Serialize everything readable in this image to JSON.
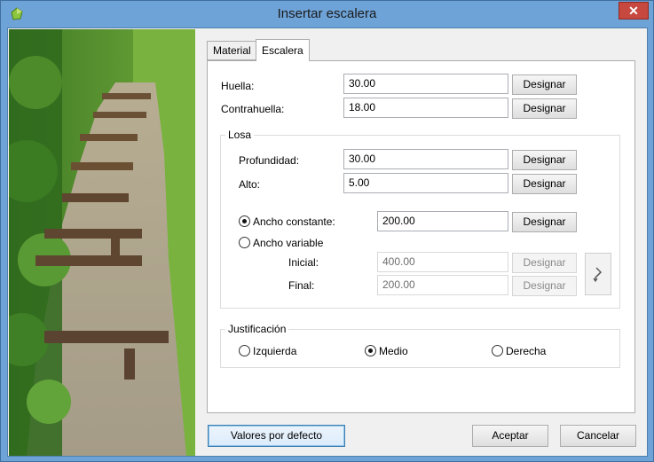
{
  "window": {
    "title": "Insertar escalera",
    "close_symbol": "✕"
  },
  "tabs": [
    {
      "label": "Material"
    },
    {
      "label": "Escalera"
    }
  ],
  "huella": {
    "label": "Huella:",
    "value": "30.00",
    "button": "Designar"
  },
  "contrahuella": {
    "label": "Contrahuella:",
    "value": "18.00",
    "button": "Designar"
  },
  "losa": {
    "title": "Losa",
    "profundidad": {
      "label": "Profundidad:",
      "value": "30.00",
      "button": "Designar"
    },
    "alto": {
      "label": "Alto:",
      "value": "5.00",
      "button": "Designar"
    },
    "ancho_constante": {
      "label": "Ancho constante:",
      "value": "200.00",
      "button": "Designar",
      "selected": true
    },
    "ancho_variable": {
      "label": "Ancho variable",
      "selected": false
    },
    "inicial": {
      "label": "Inicial:",
      "value": "400.00",
      "button": "Designar"
    },
    "final": {
      "label": "Final:",
      "value": "200.00",
      "button": "Designar"
    },
    "swap_icon": "swap-arrows-icon"
  },
  "justificacion": {
    "title": "Justificación",
    "options": [
      {
        "label": "Izquierda",
        "selected": false
      },
      {
        "label": "Medio",
        "selected": true
      },
      {
        "label": "Derecha",
        "selected": false
      }
    ]
  },
  "footer": {
    "defaults_button": "Valores por defecto",
    "accept_button": "Aceptar",
    "cancel_button": "Cancelar"
  },
  "colors": {
    "title_bar": "#6ea3d8",
    "close_button": "#c7483e",
    "dialog_bg": "#f0f0f0"
  }
}
